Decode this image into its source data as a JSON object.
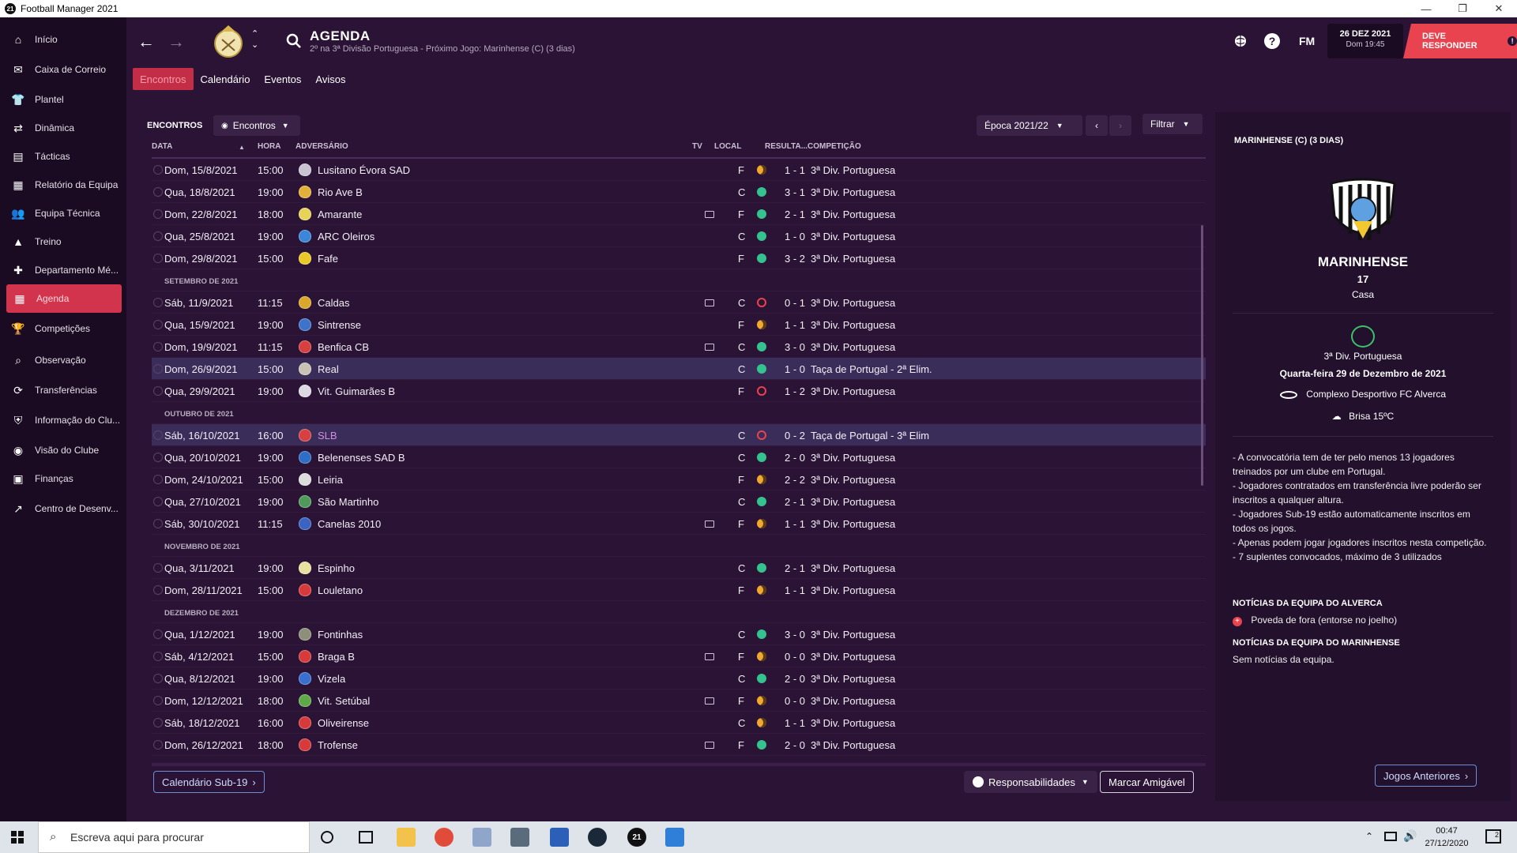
{
  "window": {
    "title": "Football Manager 2021",
    "badge": "21",
    "min": "—",
    "max": "❐",
    "close": "✕"
  },
  "sidebar": {
    "items": [
      {
        "label": "Início",
        "icon": "home-icon",
        "glyph": "⌂"
      },
      {
        "label": "Caixa de Correio",
        "icon": "inbox-icon",
        "glyph": "✉"
      },
      {
        "label": "Plantel",
        "icon": "shirt-icon",
        "glyph": "👕"
      },
      {
        "label": "Dinâmica",
        "icon": "dynamics-icon",
        "glyph": "⇄"
      },
      {
        "label": "Tácticas",
        "icon": "tactics-icon",
        "glyph": "▤"
      },
      {
        "label": "Relatório da Equipa",
        "icon": "report-icon",
        "glyph": "▦"
      },
      {
        "label": "Equipa Técnica",
        "icon": "staff-icon",
        "glyph": "👥"
      },
      {
        "label": "Treino",
        "icon": "training-icon",
        "glyph": "▲"
      },
      {
        "label": "Departamento Mé...",
        "icon": "medical-icon",
        "glyph": "✚"
      },
      {
        "label": "Agenda",
        "icon": "calendar-icon",
        "glyph": "▦",
        "active": true
      },
      {
        "label": "Competições",
        "icon": "trophy-icon",
        "glyph": "🏆"
      },
      {
        "label": "Observação",
        "icon": "scouting-icon",
        "glyph": "⌕"
      },
      {
        "label": "Transferências",
        "icon": "transfers-icon",
        "glyph": "⟳"
      },
      {
        "label": "Informação do Clu...",
        "icon": "club-info-icon",
        "glyph": "⛨"
      },
      {
        "label": "Visão do Clube",
        "icon": "club-vision-icon",
        "glyph": "◉"
      },
      {
        "label": "Finanças",
        "icon": "finances-icon",
        "glyph": "▣"
      },
      {
        "label": "Centro de Desenv...",
        "icon": "development-icon",
        "glyph": "↗"
      }
    ]
  },
  "header": {
    "back": "←",
    "forward": "→",
    "title": "AGENDA",
    "subtitle": "2º na 3ª Divisão Portuguesa - Próximo Jogo: Marinhense (C) (3 dias)",
    "fm_label": "FM",
    "date": "26 DEZ 2021",
    "time": "Dom 19:45",
    "respond": "DEVE RESPONDER",
    "respond_badge": "!"
  },
  "tabs": [
    "Encontros",
    "Calendário",
    "Eventos",
    "Avisos"
  ],
  "matches": {
    "section_title": "ENCONTROS",
    "view_dropdown": "Encontros",
    "season": "Época 2021/22",
    "filter": "Filtrar",
    "columns": {
      "date": "DATA",
      "time": "HORA",
      "opponent": "ADVERSÁRIO",
      "tv": "TV",
      "venue": "LOCAL",
      "result": "RESULTA...",
      "competition": "COMPETIÇÃO"
    },
    "rows": [
      {
        "date": "Dom, 15/8/2021",
        "time": "15:00",
        "opp": "Lusitano Évora SAD",
        "color": "#c9c2d1",
        "tv": false,
        "venue": "F",
        "res": "D",
        "score": "1 - 1",
        "comp": "3ª Div. Portuguesa"
      },
      {
        "date": "Qua, 18/8/2021",
        "time": "19:00",
        "opp": "Rio Ave B",
        "color": "#e2b03a",
        "tv": false,
        "venue": "C",
        "res": "W",
        "score": "3 - 1",
        "comp": "3ª Div. Portuguesa"
      },
      {
        "date": "Dom, 22/8/2021",
        "time": "18:00",
        "opp": "Amarante",
        "color": "#e5d35a",
        "tv": true,
        "venue": "F",
        "res": "W",
        "score": "2 - 1",
        "comp": "3ª Div. Portuguesa"
      },
      {
        "date": "Qua, 25/8/2021",
        "time": "19:00",
        "opp": "ARC Oleiros",
        "color": "#3b86d8",
        "tv": false,
        "venue": "C",
        "res": "W",
        "score": "1 - 0",
        "comp": "3ª Div. Portuguesa"
      },
      {
        "date": "Dom, 29/8/2021",
        "time": "15:00",
        "opp": "Fafe",
        "color": "#e8c928",
        "tv": false,
        "venue": "F",
        "res": "W",
        "score": "3 - 2",
        "comp": "3ª Div. Portuguesa"
      },
      {
        "month": "SETEMBRO DE 2021"
      },
      {
        "date": "Sáb, 11/9/2021",
        "time": "11:15",
        "opp": "Caldas",
        "color": "#d9a72b",
        "tv": true,
        "venue": "C",
        "res": "L",
        "score": "0 - 1",
        "comp": "3ª Div. Portuguesa"
      },
      {
        "date": "Qua, 15/9/2021",
        "time": "19:00",
        "opp": "Sintrense",
        "color": "#3e73c9",
        "tv": false,
        "venue": "F",
        "res": "D",
        "score": "1 - 1",
        "comp": "3ª Div. Portuguesa"
      },
      {
        "date": "Dom, 19/9/2021",
        "time": "11:15",
        "opp": "Benfica CB",
        "color": "#d64040",
        "tv": true,
        "venue": "C",
        "res": "W",
        "score": "3 - 0",
        "comp": "3ª Div. Portuguesa"
      },
      {
        "date": "Dom, 26/9/2021",
        "time": "15:00",
        "opp": "Real",
        "color": "#c9c1b3",
        "tv": false,
        "venue": "C",
        "res": "W",
        "score": "1 - 0",
        "comp": "Taça de Portugal - 2ª Elim.",
        "hl": true
      },
      {
        "date": "Qua, 29/9/2021",
        "time": "19:00",
        "opp": "Vit. Guimarães B",
        "color": "#ddd9e2",
        "tv": false,
        "venue": "F",
        "res": "L",
        "score": "1 - 2",
        "comp": "3ª Div. Portuguesa"
      },
      {
        "month": "OUTUBRO DE 2021"
      },
      {
        "date": "Sáb, 16/10/2021",
        "time": "16:00",
        "opp": "SLB",
        "color": "#d64040",
        "tv": false,
        "venue": "C",
        "res": "L",
        "score": "0 - 2",
        "comp": "Taça de Portugal - 3ª Elim",
        "hl": true,
        "opp_color": "#d48be0"
      },
      {
        "date": "Qua, 20/10/2021",
        "time": "19:00",
        "opp": "Belenenses SAD B",
        "color": "#2e6ec6",
        "tv": false,
        "venue": "C",
        "res": "W",
        "score": "2 - 0",
        "comp": "3ª Div. Portuguesa"
      },
      {
        "date": "Dom, 24/10/2021",
        "time": "15:00",
        "opp": "Leiria",
        "color": "#dcdcdc",
        "tv": false,
        "venue": "F",
        "res": "D",
        "score": "2 - 2",
        "comp": "3ª Div. Portuguesa"
      },
      {
        "date": "Qua, 27/10/2021",
        "time": "19:00",
        "opp": "São Martinho",
        "color": "#4f9a5a",
        "tv": false,
        "venue": "C",
        "res": "W",
        "score": "2 - 1",
        "comp": "3ª Div. Portuguesa"
      },
      {
        "date": "Sáb, 30/10/2021",
        "time": "11:15",
        "opp": "Canelas 2010",
        "color": "#3a63c2",
        "tv": true,
        "venue": "F",
        "res": "D",
        "score": "1 - 1",
        "comp": "3ª Div. Portuguesa"
      },
      {
        "month": "NOVEMBRO DE 2021"
      },
      {
        "date": "Qua, 3/11/2021",
        "time": "19:00",
        "opp": "Espinho",
        "color": "#e8e0a0",
        "tv": false,
        "venue": "C",
        "res": "W",
        "score": "2 - 1",
        "comp": "3ª Div. Portuguesa"
      },
      {
        "date": "Dom, 28/11/2021",
        "time": "15:00",
        "opp": "Louletano",
        "color": "#d63a3a",
        "tv": false,
        "venue": "F",
        "res": "D",
        "score": "1 - 1",
        "comp": "3ª Div. Portuguesa"
      },
      {
        "month": "DEZEMBRO DE 2021"
      },
      {
        "date": "Qua, 1/12/2021",
        "time": "19:00",
        "opp": "Fontinhas",
        "color": "#8c8f7a",
        "tv": false,
        "venue": "C",
        "res": "W",
        "score": "3 - 0",
        "comp": "3ª Div. Portuguesa"
      },
      {
        "date": "Sáb, 4/12/2021",
        "time": "15:00",
        "opp": "Braga B",
        "color": "#d63a3a",
        "tv": true,
        "venue": "F",
        "res": "D",
        "score": "0 - 0",
        "comp": "3ª Div. Portuguesa"
      },
      {
        "date": "Qua, 8/12/2021",
        "time": "19:00",
        "opp": "Vizela",
        "color": "#3a6fd0",
        "tv": false,
        "venue": "C",
        "res": "W",
        "score": "2 - 0",
        "comp": "3ª Div. Portuguesa"
      },
      {
        "date": "Dom, 12/12/2021",
        "time": "18:00",
        "opp": "Vit. Setúbal",
        "color": "#5fa84a",
        "tv": true,
        "venue": "F",
        "res": "D",
        "score": "0 - 0",
        "comp": "3ª Div. Portuguesa"
      },
      {
        "date": "Sáb, 18/12/2021",
        "time": "16:00",
        "opp": "Oliveirense",
        "color": "#d63a3a",
        "tv": false,
        "venue": "C",
        "res": "D",
        "score": "1 - 1",
        "comp": "3ª Div. Portuguesa"
      },
      {
        "date": "Dom, 26/12/2021",
        "time": "18:00",
        "opp": "Trofense",
        "color": "#d63a3a",
        "tv": true,
        "venue": "F",
        "res": "W",
        "score": "2 - 0",
        "comp": "3ª Div. Portuguesa"
      }
    ],
    "btn_u19": "Calendário Sub-19",
    "btn_resp": "Responsabilidades",
    "btn_friendly": "Marcar Amigável"
  },
  "next_match": {
    "title": "MARINHENSE (C) (3 DIAS)",
    "club": "MARINHENSE",
    "number": "17",
    "venue": "Casa",
    "competition": "3ª Div. Portuguesa",
    "date": "Quarta-feira 29 de Dezembro de 2021",
    "stadium": "Complexo Desportivo FC Alverca",
    "weather": "Brisa 15ºC",
    "rules": [
      "- A convocatória tem de ter pelo menos 13 jogadores treinados por um clube em Portugal.",
      "- Jogadores contratados em transferência livre poderão ser inscritos a qualquer altura.",
      "- Jogadores Sub-19 estão automaticamente inscritos em todos os jogos.",
      "- Apenas podem jogar jogadores inscritos nesta competição.",
      "- 7 suplentes convocados, máximo de 3 utilizados"
    ],
    "news_alverca_title": "NOTÍCIAS DA EQUIPA DO ALVERCA",
    "news_alverca_text": "Poveda de fora (entorse no joelho)",
    "news_marinhense_title": "NOTÍCIAS DA EQUIPA DO MARINHENSE",
    "news_marinhense_text": "Sem notícias da equipa.",
    "btn_previous": "Jogos Anteriores"
  },
  "taskbar": {
    "search_placeholder": "Escreva aqui para procurar",
    "time": "00:47",
    "date": "27/12/2020",
    "notif_count": "2"
  },
  "colors": {
    "accent": "#d2344e",
    "win": "#34c38f",
    "draw": "#f0a82e",
    "loss": "#e8434f",
    "bg": "#2a1335"
  }
}
